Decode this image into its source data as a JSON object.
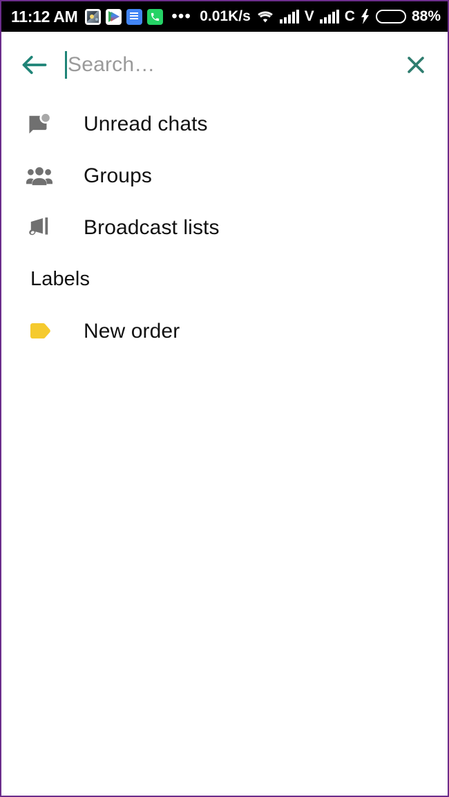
{
  "status_bar": {
    "clock": "11:12 AM",
    "notification_icons": [
      {
        "name": "photos-icon",
        "label": "Photos"
      },
      {
        "name": "play-store-icon",
        "label": "Google Play Store"
      },
      {
        "name": "docs-icon",
        "label": "Document"
      },
      {
        "name": "phone-call-icon",
        "label": "Phone"
      }
    ],
    "overflow_dots": "•••",
    "network_speed": "0.01K/s",
    "wifi_icon": "wifi-icon",
    "signal_icon_1": "signal-bars-icon",
    "sim1_letter": "V",
    "signal_icon_2": "signal-bars-icon",
    "sim2_letter": "C",
    "charging_icon": "lightning-bolt-icon",
    "battery_level": 88,
    "battery_percent": "88%",
    "battery_color": "#32d74b",
    "background": "#000000"
  },
  "search": {
    "back_icon": "arrow-left-icon",
    "placeholder": "Search…",
    "value": "",
    "close_icon": "close-icon",
    "accent_color": "#1f8477"
  },
  "menu": {
    "items": [
      {
        "label": "Unread chats",
        "icon": "mark-unread-chat-icon",
        "icon_color": "#707070"
      },
      {
        "label": "Groups",
        "icon": "groups-icon",
        "icon_color": "#707070"
      },
      {
        "label": "Broadcast lists",
        "icon": "megaphone-icon",
        "icon_color": "#707070"
      }
    ]
  },
  "labels_section": {
    "header": "Labels",
    "items": [
      {
        "label": "New order",
        "icon": "label-tag-icon",
        "color": "#f5ca2e"
      }
    ]
  }
}
